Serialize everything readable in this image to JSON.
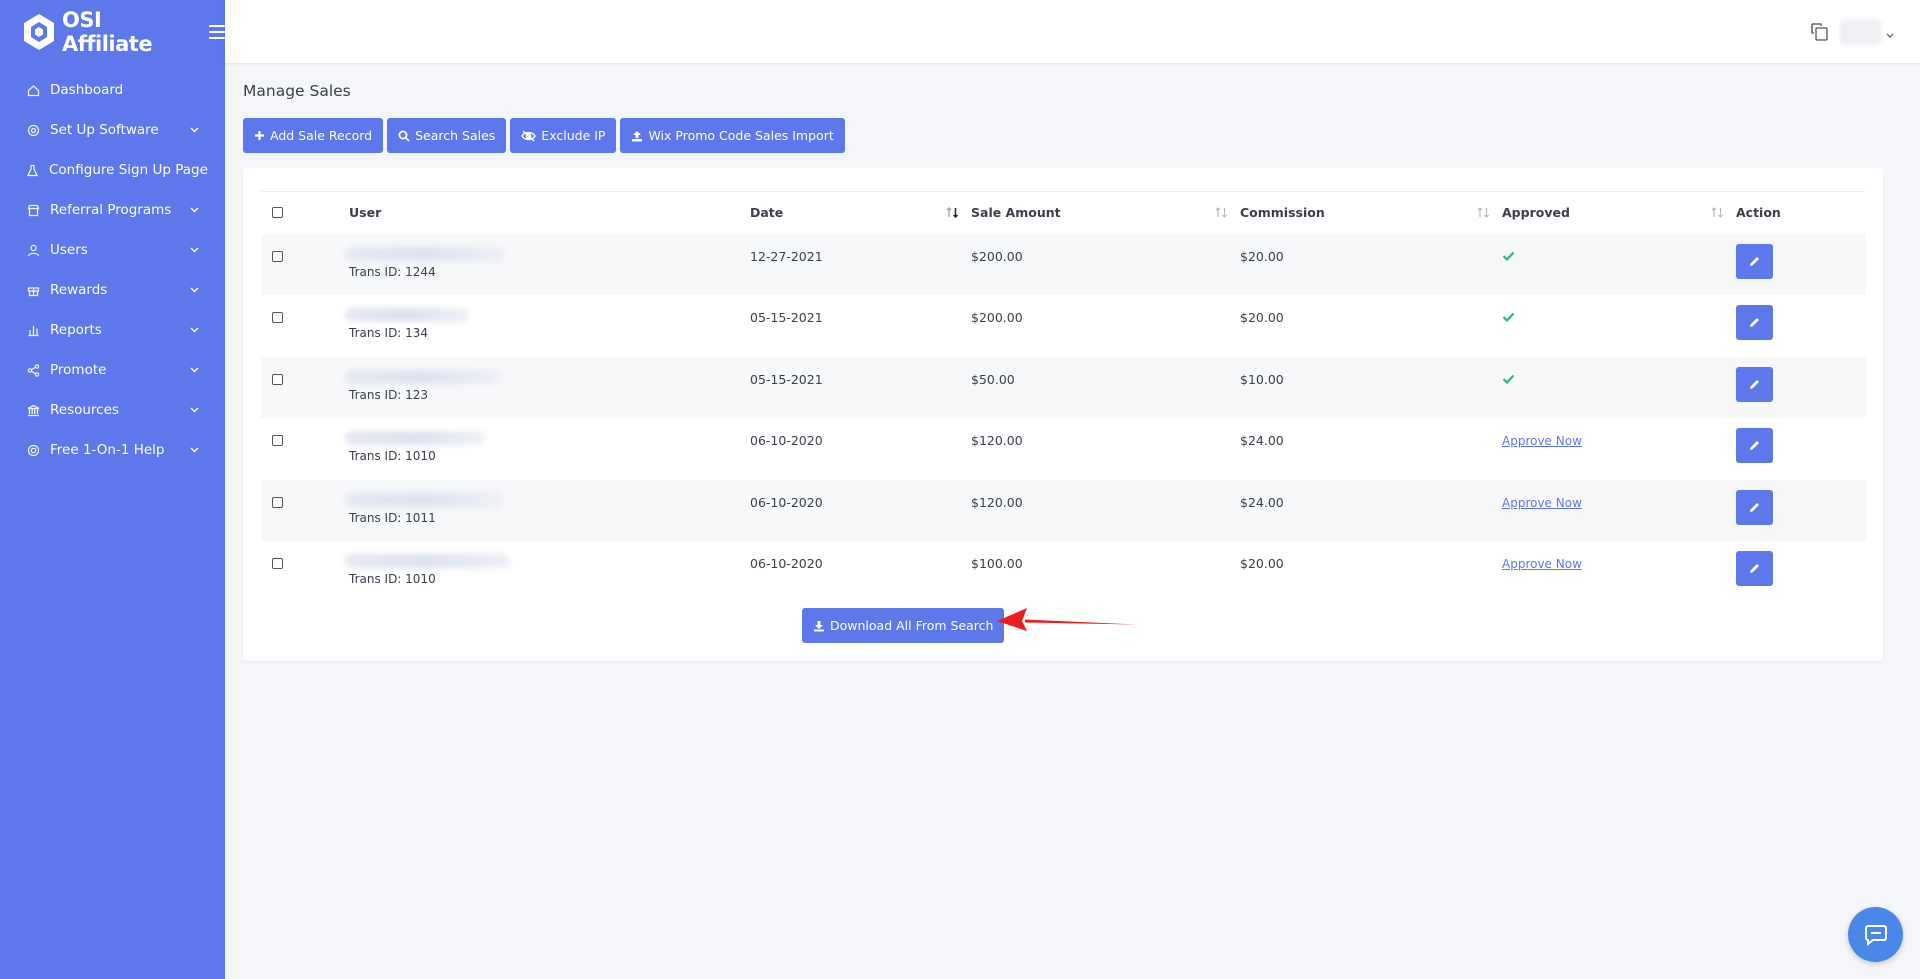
{
  "brand": {
    "name": "OSI Affiliate"
  },
  "sidebar": {
    "items": [
      {
        "label": "Dashboard",
        "icon": "home-icon",
        "has_submenu": false
      },
      {
        "label": "Set Up Software",
        "icon": "cog-icon",
        "has_submenu": true
      },
      {
        "label": "Configure Sign Up Page",
        "icon": "flask-icon",
        "has_submenu": false
      },
      {
        "label": "Referral Programs",
        "icon": "store-icon",
        "has_submenu": true
      },
      {
        "label": "Users",
        "icon": "user-icon",
        "has_submenu": true
      },
      {
        "label": "Rewards",
        "icon": "gift-icon",
        "has_submenu": true
      },
      {
        "label": "Reports",
        "icon": "bar-chart-icon",
        "has_submenu": true
      },
      {
        "label": "Promote",
        "icon": "share-icon",
        "has_submenu": true
      },
      {
        "label": "Resources",
        "icon": "bank-icon",
        "has_submenu": true
      },
      {
        "label": "Free 1-On-1 Help",
        "icon": "lifebuoy-icon",
        "has_submenu": true
      }
    ]
  },
  "page": {
    "title": "Manage Sales"
  },
  "toolbar": {
    "add_label": "Add Sale Record",
    "search_label": "Search Sales",
    "exclude_label": "Exclude IP",
    "import_label": "Wix Promo Code Sales Import"
  },
  "table": {
    "columns": [
      "User",
      "Date",
      "Sale Amount",
      "Commission",
      "Approved",
      "Action"
    ],
    "rows": [
      {
        "trans": "Trans ID: 1244",
        "date": "12-27-2021",
        "amount": "$200.00",
        "commission": "$20.00",
        "approved": true
      },
      {
        "trans": "Trans ID: 134",
        "date": "05-15-2021",
        "amount": "$200.00",
        "commission": "$20.00",
        "approved": true
      },
      {
        "trans": "Trans ID: 123",
        "date": "05-15-2021",
        "amount": "$50.00",
        "commission": "$10.00",
        "approved": true
      },
      {
        "trans": "Trans ID: 1010",
        "date": "06-10-2020",
        "amount": "$120.00",
        "commission": "$24.00",
        "approved": false
      },
      {
        "trans": "Trans ID: 1011",
        "date": "06-10-2020",
        "amount": "$120.00",
        "commission": "$24.00",
        "approved": false
      },
      {
        "trans": "Trans ID: 1010",
        "date": "06-10-2020",
        "amount": "$100.00",
        "commission": "$20.00",
        "approved": false
      }
    ],
    "approve_now_label": "Approve Now"
  },
  "download": {
    "label": "Download All From Search"
  },
  "colors": {
    "primary": "#5d78eb",
    "check": "#2fb67a",
    "arrow": "#ee1c1c",
    "chat": "#4a88e8"
  }
}
